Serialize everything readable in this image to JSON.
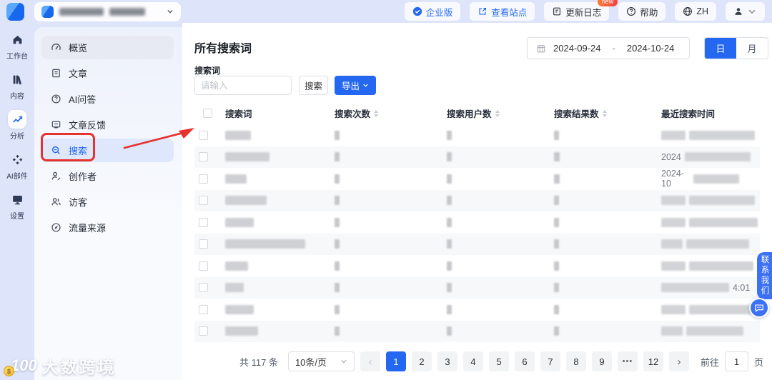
{
  "topbar": {
    "buttons": {
      "enterprise": "企业版",
      "view_site": "查看站点",
      "changelog": "更新日志",
      "changelog_badge": "new",
      "help": "帮助",
      "language": "ZH"
    },
    "icons": [
      "check-circle-icon",
      "external-link-icon",
      "changelog-icon",
      "question-circle-icon",
      "globe-icon",
      "user-icon",
      "chevron-down-icon"
    ]
  },
  "left_rail": {
    "items": [
      {
        "label": "工作台",
        "icon": "home-icon",
        "active": false
      },
      {
        "label": "内容",
        "icon": "content-icon",
        "active": false
      },
      {
        "label": "分析",
        "icon": "analytics-icon",
        "active": true
      },
      {
        "label": "AI部件",
        "icon": "ai-parts-icon",
        "active": false
      },
      {
        "label": "设置",
        "icon": "settings-icon",
        "active": false
      }
    ]
  },
  "sidebar": {
    "items": [
      {
        "label": "概览",
        "icon": "gauge-icon",
        "state": "hovered"
      },
      {
        "label": "文章",
        "icon": "article-icon",
        "state": "normal"
      },
      {
        "label": "AI问答",
        "icon": "ai-qa-icon",
        "state": "normal"
      },
      {
        "label": "文章反馈",
        "icon": "feedback-icon",
        "state": "normal"
      },
      {
        "label": "搜索",
        "icon": "search-icon",
        "state": "active",
        "annotated": true
      },
      {
        "label": "创作者",
        "icon": "creator-icon",
        "state": "normal"
      },
      {
        "label": "访客",
        "icon": "visitors-icon",
        "state": "normal"
      },
      {
        "label": "流量来源",
        "icon": "traffic-icon",
        "state": "normal"
      }
    ]
  },
  "main": {
    "title": "所有搜索词",
    "date_range": {
      "start": "2024-09-24",
      "separator": "-",
      "end": "2024-10-24"
    },
    "granularity": {
      "options": [
        "日",
        "月"
      ],
      "selected": "日"
    },
    "filter": {
      "label": "搜索词",
      "placeholder": "请输入",
      "search_button": "搜索",
      "export_button": "导出"
    },
    "table": {
      "columns": [
        {
          "label": "搜索词",
          "sortable": false
        },
        {
          "label": "搜索次数",
          "sortable": true
        },
        {
          "label": "搜索用户数",
          "sortable": true
        },
        {
          "label": "搜索结果数",
          "sortable": true
        },
        {
          "label": "最近搜索时间",
          "sortable": false
        }
      ],
      "rows": [
        {
          "redacted": true,
          "term_w": 36,
          "count_w": 7,
          "users_w": 7,
          "results_w": 7,
          "time_prefix": "",
          "time_blobs": [
            34,
            92
          ],
          "time_suffix": ""
        },
        {
          "redacted": true,
          "term_w": 62,
          "count_w": 7,
          "users_w": 7,
          "results_w": 8,
          "time_prefix": "2024",
          "time_blobs": [
            92
          ],
          "time_suffix": ""
        },
        {
          "redacted": true,
          "term_w": 30,
          "count_w": 7,
          "users_w": 7,
          "results_w": 8,
          "time_prefix": "2024-10",
          "time_blobs": [
            72
          ],
          "time_suffix": ""
        },
        {
          "redacted": true,
          "term_w": 58,
          "count_w": 7,
          "users_w": 7,
          "results_w": 7,
          "time_prefix": "",
          "time_blobs": [
            34,
            92
          ],
          "time_suffix": ""
        },
        {
          "redacted": true,
          "term_w": 40,
          "count_w": 7,
          "users_w": 7,
          "results_w": 7,
          "time_prefix": "",
          "time_blobs": [
            34,
            96
          ],
          "time_suffix": ""
        },
        {
          "redacted": true,
          "term_w": 112,
          "count_w": 7,
          "users_w": 7,
          "results_w": 7,
          "time_prefix": "",
          "time_blobs": [
            30,
            88
          ],
          "time_suffix": ""
        },
        {
          "redacted": true,
          "term_w": 32,
          "count_w": 7,
          "users_w": 7,
          "results_w": 7,
          "time_prefix": "",
          "time_blobs": [
            34,
            90
          ],
          "time_suffix": ""
        },
        {
          "redacted": true,
          "term_w": 26,
          "count_w": 7,
          "users_w": 7,
          "results_w": 7,
          "time_prefix": "",
          "time_blobs": [
            95
          ],
          "time_suffix": "4:01"
        },
        {
          "redacted": true,
          "term_w": 40,
          "count_w": 7,
          "users_w": 7,
          "results_w": 7,
          "time_prefix": "",
          "time_blobs": [
            34,
            94
          ],
          "time_suffix": ""
        },
        {
          "redacted": true,
          "term_w": 46,
          "count_w": 7,
          "users_w": 7,
          "results_w": 7,
          "time_prefix": "",
          "time_blobs": [
            30,
            80
          ],
          "time_suffix": ""
        }
      ]
    },
    "pagination": {
      "total_text": "共 117 条",
      "page_size": "10条/页",
      "prev_icon": "‹",
      "next_icon": "›",
      "pages": [
        "1",
        "2",
        "3",
        "4",
        "5",
        "6",
        "7",
        "8",
        "9",
        "•••",
        "12"
      ],
      "active_page": "1",
      "goto_label": "前往",
      "goto_value": "1",
      "goto_suffix": "页"
    }
  },
  "contact": {
    "label": "联系我们",
    "icon": "chat-bubble-icon"
  },
  "watermark": {
    "logo_number": "100",
    "logo_currency": "$",
    "text": "大数跨境"
  },
  "colors": {
    "accent": "#2468f2",
    "annotation": "#e7312c",
    "badge": "#f53f3f",
    "contact_blue": "#3d71f5",
    "topbar_bg": "#dee4fa"
  }
}
